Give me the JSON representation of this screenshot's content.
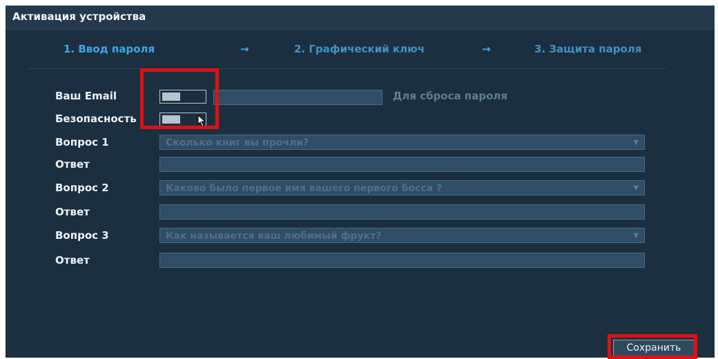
{
  "window": {
    "title": "Активация устройства"
  },
  "steps": [
    {
      "label": "1.  Ввод пароля"
    },
    {
      "label": "2.  Графический ключ"
    },
    {
      "label": "3.  Защита пароля"
    }
  ],
  "step_arrow": "→",
  "form": {
    "email": {
      "label": "Ваш Email",
      "value": "",
      "hint": "Для сброса пароля",
      "toggle_on": false
    },
    "security": {
      "label": "Безопасность",
      "toggle_on": false
    },
    "questions": [
      {
        "label": "Вопрос 1",
        "selected": "Сколько книг вы прочли?",
        "answer_label": "Ответ",
        "answer": ""
      },
      {
        "label": "Вопрос 2",
        "selected": "Каково было первое имя вашего первого босса ?",
        "answer_label": "Ответ",
        "answer": ""
      },
      {
        "label": "Вопрос 3",
        "selected": "Как называется ваш любимый фрукт?",
        "answer_label": "Ответ",
        "answer": ""
      }
    ]
  },
  "footer": {
    "save_label": "Сохранить"
  },
  "colors": {
    "highlight": "#e01010",
    "background": "#1c2f40",
    "accent": "#3da7e6"
  }
}
